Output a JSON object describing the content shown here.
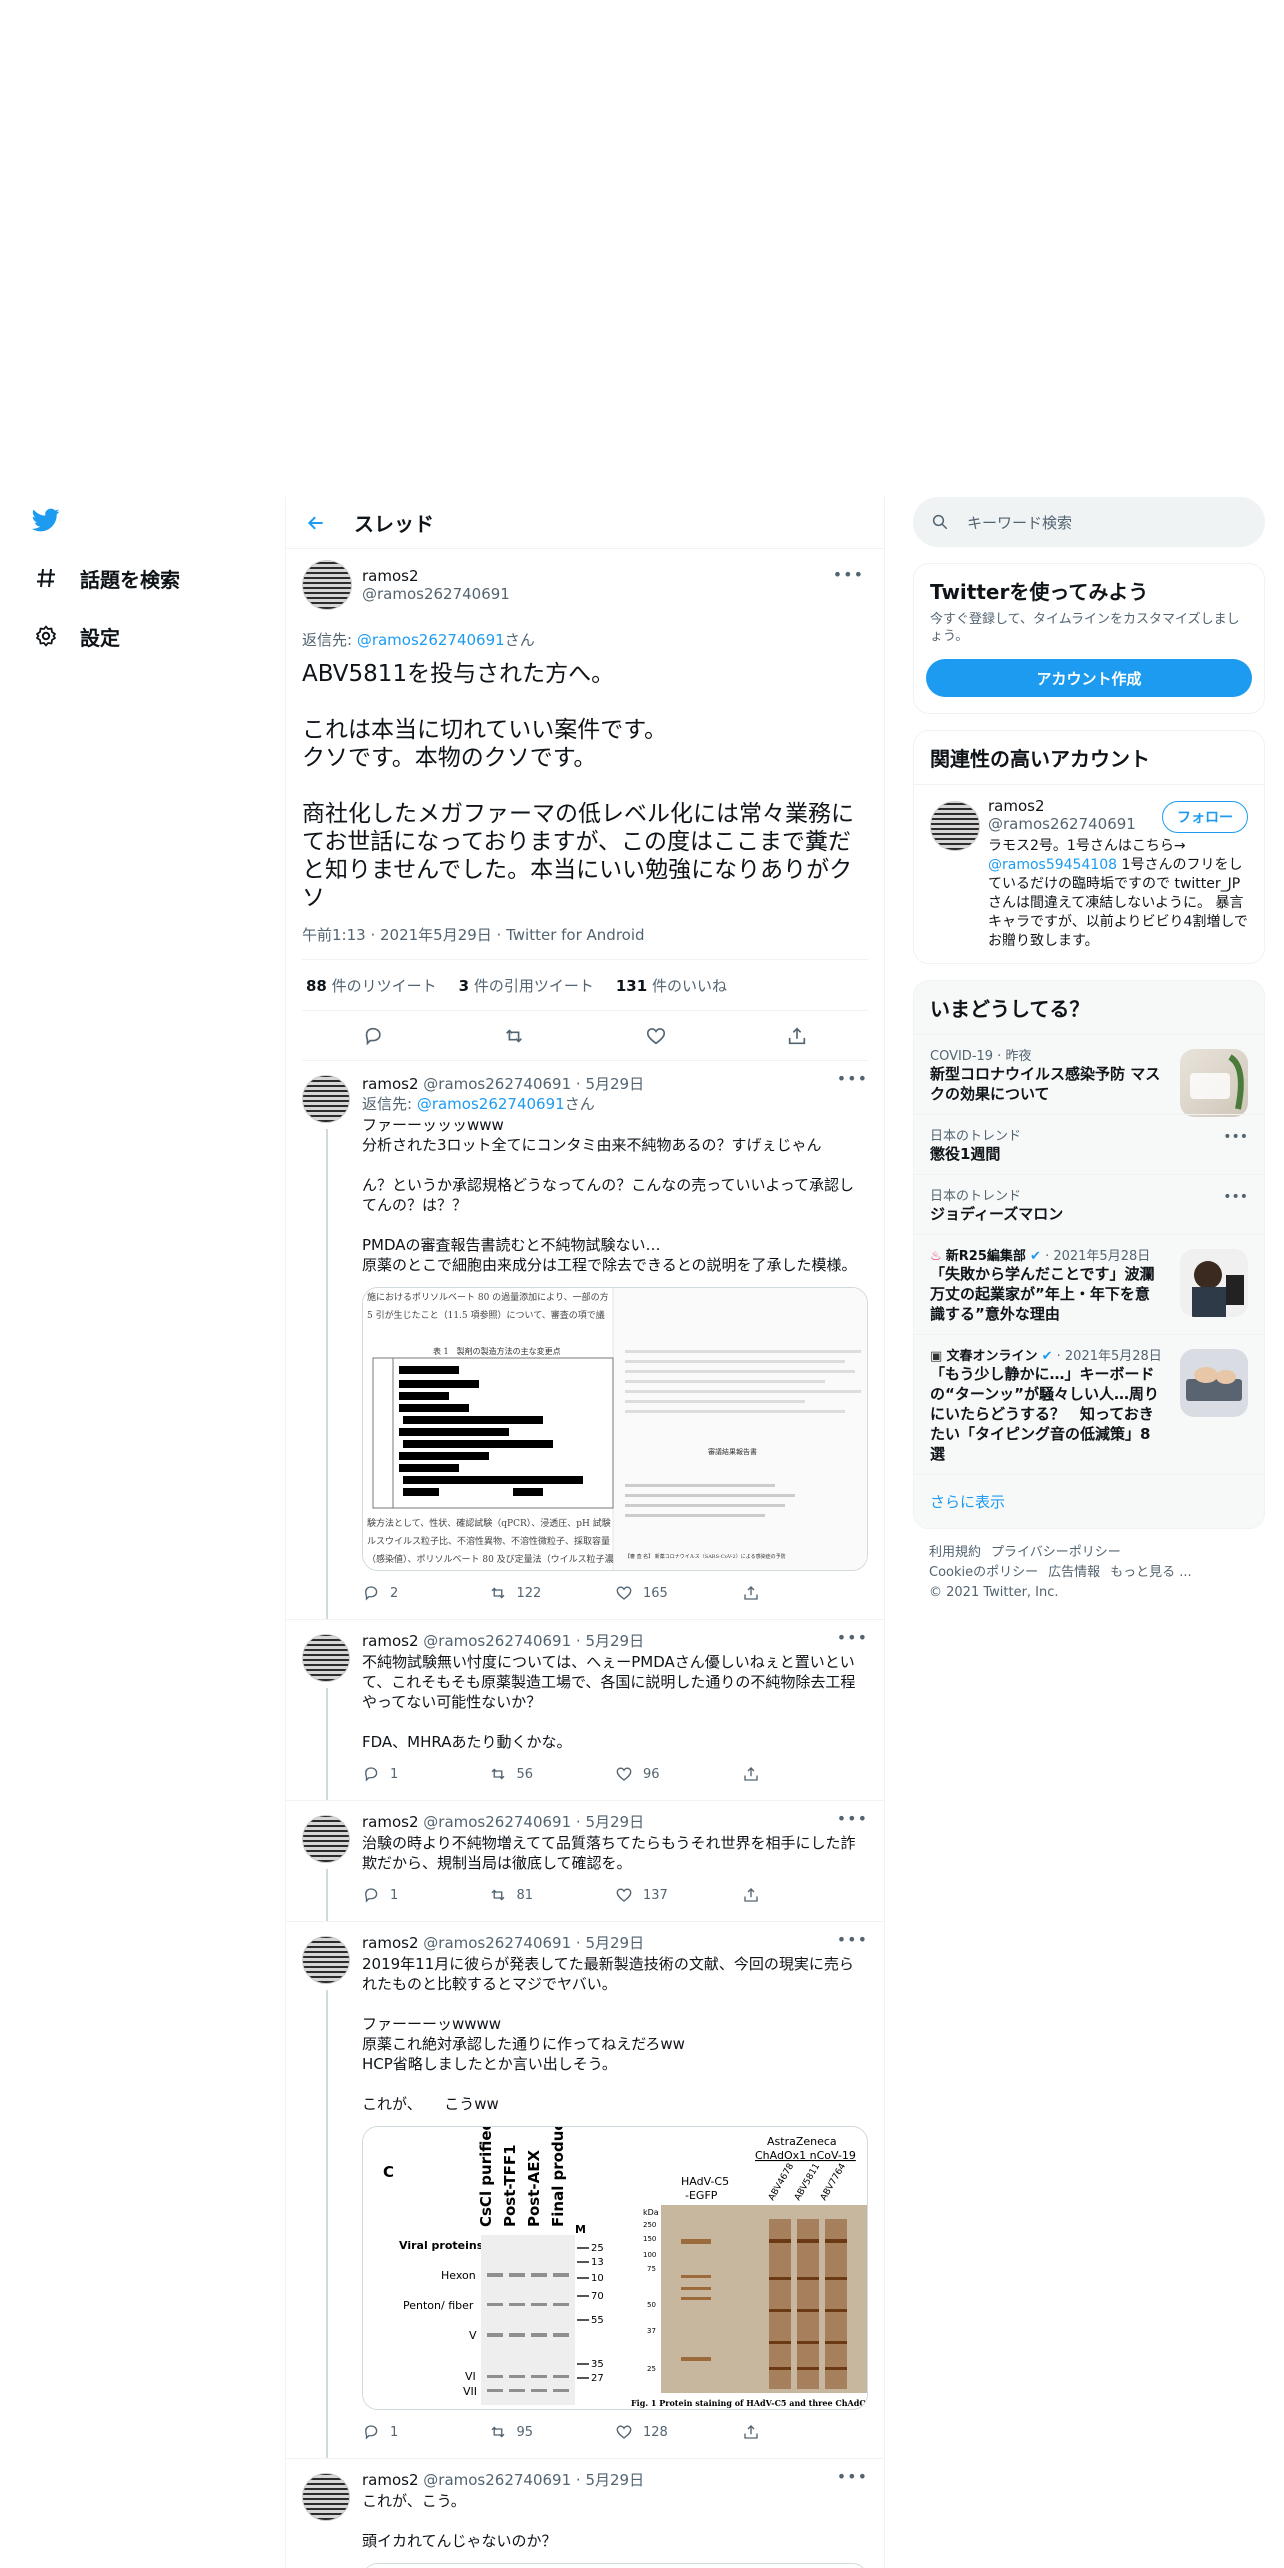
{
  "nav": {
    "items": [
      {
        "label": "話題を検索",
        "icon": "hash-icon"
      },
      {
        "label": "設定",
        "icon": "gear-icon"
      }
    ]
  },
  "thread": {
    "title": "スレッド",
    "main": {
      "name": "ramos2",
      "handle": "@ramos262740691",
      "reply_prefix": "返信先: ",
      "reply_handle": "@ramos262740691",
      "reply_suffix": "さん",
      "text": "ABV5811を投与された方へ。\n\nこれは本当に切れていい案件です。\nクソです。本物のクソです。\n\n商社化したメガファーマの低レベル化には常々業務にてお世話になっておりますが、この度はここまで糞だと知りませんでした。本当にいい勉強になりありがクソ",
      "meta": "午前1:13 · 2021年5月29日 · Twitter for Android",
      "retweets": "88",
      "retweets_label": " 件のリツイート",
      "quotes": "3",
      "quotes_label": " 件の引用ツイート",
      "likes": "131",
      "likes_label": " 件のいいね"
    },
    "replies": [
      {
        "name": "ramos2",
        "meta": " @ramos262740691 · 5月29日",
        "reply_prefix": "返信先: ",
        "reply_handle": "@ramos262740691",
        "reply_suffix": "さん",
        "text": "ファーーッッッwww\n分析された3ロット全てにコンタミ由来不純物あるの？すげぇじゃん\n\nん？というか承認規格どうなってんの？こんなの売っていいよって承認してんの？は？？\n\nPMDAの審査報告書読むと不純物試験ない…\n原薬のとこで細胞由来成分は工程で除去できるとの説明を了承した模様。",
        "replies": "2",
        "retweets": "122",
        "likes": "165"
      },
      {
        "name": "ramos2",
        "meta": " @ramos262740691 · 5月29日",
        "text": "不純物試験無い忖度については、へぇーPMDAさん優しいねぇと置いといて、これそもそも原薬製造工場で、各国に説明した通りの不純物除去工程やってない可能性ないか？\n\nFDA、MHRAあたり動くかな。",
        "replies": "1",
        "retweets": "56",
        "likes": "96"
      },
      {
        "name": "ramos2",
        "meta": " @ramos262740691 · 5月29日",
        "text": "治験の時より不純物増えてて品質落ちてたらもうそれ世界を相手にした詐欺だから、規制当局は徹底して確認を。",
        "replies": "1",
        "retweets": "81",
        "likes": "137"
      },
      {
        "name": "ramos2",
        "meta": " @ramos262740691 · 5月29日",
        "text": "2019年11月に彼らが発表してた最新製造技術の文献、今回の現実に売られたものと比較するとマジでヤバい。\n\nファーーーッwwww\n原薬これ絶対承認した通りに作ってねえだろww\nHCP省略しましたとか言い出しそう。\n\nこれが、　　こうww",
        "replies": "1",
        "retweets": "95",
        "likes": "128"
      },
      {
        "name": "ramos2",
        "meta": " @ramos262740691 · 5月29日",
        "text": "これが、こう。\n\n頭イカれてんじゃないのか？"
      }
    ],
    "doc_image": {
      "top_line1": "施におけるポリソルベート 80 の過量添加により、一部の方",
      "top_line2": "5 引が生じたこと（11.5 項参照）について、審査の項で議",
      "table_title": "表 1　製剤の製造方法の主な変更点",
      "bottom1": "験方法として、性状、確認試験（qPCR）、浸透圧、pH 試験",
      "bottom2": "ルスウイルス粒子比、不溶性異物、不溶性微粒子、採取容量",
      "bottom3": "（感染値）、ポリソルベート 80 及び定量法（ウイルス粒子濃",
      "right_title": "審議結果報告書",
      "right_footer": "【審 査 名】 新薬コロナウイルス（SARS-CoV-2）による感染症の予防"
    },
    "gel_image": {
      "panel_label": "C",
      "col_labels": [
        "CsCl purified",
        "Post-TFF1",
        "Post-AEX",
        "Final product"
      ],
      "mw_label": "M",
      "row_title": "Viral proteins",
      "rows": [
        "Hexon",
        "Penton/ fiber",
        "V",
        "VI",
        "VII"
      ],
      "mw_marks": [
        "25",
        "13",
        "10",
        "70",
        "55",
        "35",
        "27"
      ],
      "right_header1": "AstraZeneca",
      "right_header2": "ChAdOx1 nCoV-19",
      "right_col1a": "HAdV-C5",
      "right_col1b": "-EGFP",
      "right_cols": [
        "ABV4678",
        "ABV5811",
        "ABV7764"
      ],
      "kda_label": "kDa",
      "kda_marks": [
        "250",
        "150",
        "100",
        "75",
        "50",
        "37",
        "25"
      ],
      "caption": "Fig. 1 Protein staining of HAdV-C5 and three ChAdOx1 nC"
    }
  },
  "sidebar": {
    "search_placeholder": "キーワード検索",
    "signup": {
      "title": "Twitterを使ってみよう",
      "subtitle": "今すぐ登録して、タイムラインをカスタマイズしましょう。",
      "button": "アカウント作成"
    },
    "related": {
      "title": "関連性の高いアカウント",
      "name": "ramos2",
      "handle": "@ramos262740691",
      "follow": "フォロー",
      "bio_prefix": "ラモス2号。1号さんはこちら→",
      "bio_link": "@ramos59454108",
      "bio_suffix": " 1号さんのフリをしているだけの臨時垢ですので twitter_JPさんは間違えて凍結しないように。 暴言キャラですが、以前よりビビり4割増しでお贈り致します。"
    },
    "trends": {
      "title": "いまどうしてる？",
      "items": [
        {
          "context": "COVID-19 · 昨夜",
          "title": "新型コロナウイルス感染予防 マスクの効果について"
        },
        {
          "context": "日本のトレンド",
          "title": "懲役1週間"
        },
        {
          "context": "日本のトレンド",
          "title": "ジョディーズマロン"
        },
        {
          "source": "新R25編集部",
          "date": " · 2021年5月28日",
          "title": "「失敗から学んだことです」波瀾万丈の起業家が”年上・年下を意識する”意外な理由"
        },
        {
          "source": "文春オンライン",
          "date": " · 2021年5月28日",
          "title": "「もう少し静かに…」キーボードの“ターンッ”が騒々しい人…周りにいたらどうする？　知っておきたい「タイピング音の低減策」8選"
        }
      ],
      "more": "さらに表示"
    },
    "footer": {
      "links": [
        "利用規約",
        "プライバシーポリシー",
        "Cookieのポリシー",
        "広告情報",
        "もっと見る ..."
      ],
      "copyright": "© 2021 Twitter, Inc."
    }
  },
  "colors": {
    "accent": "#1d9bf0",
    "text": "#0f1419",
    "muted": "#536471",
    "border": "#eff3f4"
  }
}
